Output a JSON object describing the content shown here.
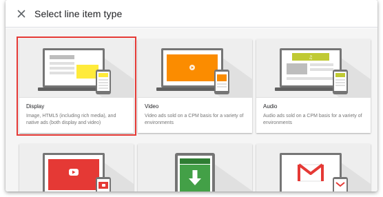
{
  "dialog": {
    "title": "Select line item type",
    "close_icon": "close-icon"
  },
  "cards": [
    {
      "title": "Display",
      "description": "Image, HTML5 (including rich media), and native ads (both display and video)",
      "icon": "display-ad-illustration",
      "selected": true
    },
    {
      "title": "Video",
      "description": "Video ads sold on a CPM basis for a variety of environments",
      "icon": "video-ad-illustration",
      "selected": false
    },
    {
      "title": "Audio",
      "description": "Audio ads sold on a CPM basis for a variety of environments",
      "icon": "audio-ad-illustration",
      "selected": false
    },
    {
      "icon": "youtube-ad-illustration"
    },
    {
      "icon": "mobile-app-install-illustration"
    },
    {
      "icon": "gmail-ad-illustration"
    }
  ],
  "colors": {
    "selected_outline": "#e53935",
    "display_accent": "#ffeb3b",
    "video_accent": "#fb8c00",
    "audio_accent": "#c0ca33",
    "youtube_red": "#e53935",
    "app_green": "#43a047",
    "gmail_red": "#e53935"
  }
}
